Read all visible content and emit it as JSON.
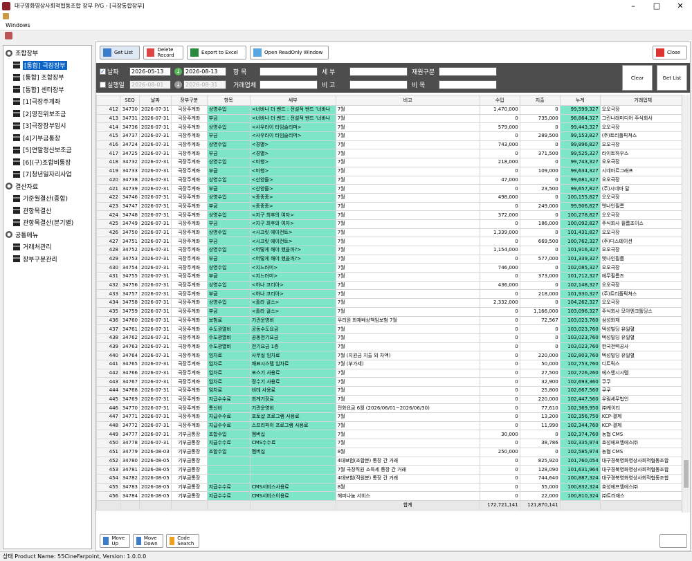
{
  "window": {
    "title": "대구영화영상사회적협동조합 장부 P/G - [극장통합장부]",
    "menu": "Windows"
  },
  "tree": [
    {
      "label": "조합장부",
      "type": "root"
    },
    {
      "label": "[통합] 극장장부",
      "type": "child",
      "selected": true
    },
    {
      "label": "[통합] 조합장부",
      "type": "child"
    },
    {
      "label": "[통합] 센터장부",
      "type": "child"
    },
    {
      "label": "[1]극장주계좌",
      "type": "child"
    },
    {
      "label": "[2]영진위보조금",
      "type": "child"
    },
    {
      "label": "[3]극장장부임시",
      "type": "child"
    },
    {
      "label": "[4]기부금통장",
      "type": "child"
    },
    {
      "label": "[5]연말정산보조금",
      "type": "child"
    },
    {
      "label": "[6](구)조합비통장",
      "type": "child"
    },
    {
      "label": "[7]청년일자리사업",
      "type": "child"
    },
    {
      "label": "결산자료",
      "type": "root"
    },
    {
      "label": "기준월결산(종합)",
      "type": "child"
    },
    {
      "label": "관항목결산",
      "type": "child"
    },
    {
      "label": "관항목결산(분기별)",
      "type": "child"
    },
    {
      "label": "공통메뉴",
      "type": "root"
    },
    {
      "label": "거래처관리",
      "type": "child"
    },
    {
      "label": "장부구분관리",
      "type": "child"
    }
  ],
  "toolbar": {
    "get_list": "Get List",
    "delete_record": "Delete Record",
    "export_excel": "Export to Excel",
    "readonly_window": "Open ReadOnly Window",
    "close": "Close"
  },
  "filter": {
    "date_label": "날짜",
    "exec_label": "실행일",
    "date_from": "2026-05-13",
    "date_to": "2026-08-13",
    "exec_from": "2026-08-01",
    "exec_to": "2026-08-31",
    "hangmok_label": "항 목",
    "semu_label": "세 부",
    "jaewon_label": "재원구분",
    "georae_label": "거래업체",
    "bigo_label": "비 고",
    "bimok_label": "비 목",
    "clear": "Clear",
    "get_list": "Get List"
  },
  "columns": [
    "SEQ",
    "날짜",
    "장부구분",
    "항목",
    "세부",
    "비고",
    "수입",
    "지출",
    "누계",
    "거래업체"
  ],
  "rows": [
    [
      "412",
      "34730",
      "2026-07-31",
      "극장주계좌",
      "상영수입",
      "<너바나 더 밴드 : 전설적 밴드 '너바나",
      "7월",
      "1,470,000",
      "0",
      "99,599,327",
      "오오극장"
    ],
    [
      "413",
      "34731",
      "2026-07-31",
      "극장주계좌",
      "부금",
      "<너바나 더 밴드 : 전설적 밴드 '너바나",
      "7월",
      "0",
      "735,000",
      "98,864,327",
      "그린나래미디어 주식회사"
    ],
    [
      "414",
      "34736",
      "2026-07-31",
      "극장주계좌",
      "상영수입",
      "<사우라이 타임슬리퍼>",
      "7월",
      "579,000",
      "0",
      "99,443,327",
      "오오극장"
    ],
    [
      "415",
      "34737",
      "2026-07-31",
      "극장주계좌",
      "부금",
      "<사우라이 타임슬리퍼>",
      "7월",
      "0",
      "289,500",
      "99,153,827",
      "(주)트리플픽쳐스"
    ],
    [
      "416",
      "34724",
      "2026-07-31",
      "극장주계좌",
      "상영수입",
      "<경멸>",
      "7월",
      "743,000",
      "0",
      "99,896,827",
      "오오극장"
    ],
    [
      "417",
      "34725",
      "2026-07-31",
      "극장주계좌",
      "부금",
      "<경멸>",
      "7월",
      "0",
      "371,500",
      "99,525,327",
      "라이트하우스"
    ],
    [
      "418",
      "34732",
      "2026-07-31",
      "극장주계좌",
      "상영수입",
      "<미행>",
      "7월",
      "218,000",
      "0",
      "99,743,327",
      "오오극장"
    ],
    [
      "419",
      "34733",
      "2026-07-31",
      "극장주계좌",
      "부금",
      "<미행>",
      "7월",
      "0",
      "109,000",
      "99,634,327",
      "시네마르그래프"
    ],
    [
      "420",
      "34738",
      "2026-07-31",
      "극장주계좌",
      "상영수입",
      "<산양들>",
      "7월",
      "47,000",
      "0",
      "99,681,327",
      "오오극장"
    ],
    [
      "421",
      "34739",
      "2026-07-31",
      "극장주계좌",
      "부금",
      "<산양들>",
      "7월",
      "0",
      "23,500",
      "99,657,827",
      "(주)시네마 달"
    ],
    [
      "422",
      "34746",
      "2026-07-31",
      "극장주계좌",
      "상영수입",
      "<종종종>",
      "7월",
      "498,000",
      "0",
      "100,155,827",
      "오오극장"
    ],
    [
      "423",
      "34747",
      "2026-07-31",
      "극장주계좌",
      "부금",
      "<종종종>",
      "7월",
      "0",
      "249,000",
      "99,906,827",
      "엣나인필름"
    ],
    [
      "424",
      "34748",
      "2026-07-31",
      "극장주계좌",
      "상영수입",
      "<지구 최후의 여자>",
      "7월",
      "372,000",
      "0",
      "100,278,827",
      "오오극장"
    ],
    [
      "425",
      "34749",
      "2026-07-31",
      "극장주계좌",
      "부금",
      "<지구 최후의 여자>",
      "7월",
      "0",
      "186,000",
      "100,092,827",
      "주식회사 필름조이스"
    ],
    [
      "426",
      "34750",
      "2026-07-31",
      "극장주계좌",
      "상영수입",
      "<시크릿 에이전트>",
      "7월",
      "1,339,000",
      "0",
      "101,431,827",
      "오오극장"
    ],
    [
      "427",
      "34751",
      "2026-07-31",
      "극장주계좌",
      "부금",
      "<시크릿 에이전트>",
      "7월",
      "0",
      "669,500",
      "100,762,327",
      "(주)디스테이션"
    ],
    [
      "428",
      "34752",
      "2026-07-31",
      "극장주계좌",
      "상영수입",
      "<어떻게 해야 했을까?>",
      "7월",
      "1,154,000",
      "0",
      "101,916,327",
      "오오극장"
    ],
    [
      "429",
      "34753",
      "2026-07-31",
      "극장주계좌",
      "부금",
      "<어떻게 해야 했을까?>",
      "7월",
      "0",
      "577,000",
      "101,339,327",
      "엣나인필름"
    ],
    [
      "430",
      "34754",
      "2026-07-31",
      "극장주계좌",
      "상영수입",
      "<지느러미>",
      "7월",
      "746,000",
      "0",
      "102,085,327",
      "오오극장"
    ],
    [
      "431",
      "34755",
      "2026-07-31",
      "극장주계좌",
      "부금",
      "<지느러미>",
      "7월",
      "0",
      "373,000",
      "101,712,327",
      "에무필름즈"
    ],
    [
      "432",
      "34756",
      "2026-07-31",
      "극장주계좌",
      "상영수입",
      "<하나 코리아>",
      "7월",
      "436,000",
      "0",
      "102,148,327",
      "오오극장"
    ],
    [
      "433",
      "34757",
      "2026-07-31",
      "극장주계좌",
      "부금",
      "<하나 코리아>",
      "7월",
      "0",
      "218,000",
      "101,930,327",
      "(주)트리플픽쳐스"
    ],
    [
      "434",
      "34758",
      "2026-07-31",
      "극장주계좌",
      "상영수입",
      "<홀라 걸스>",
      "7월",
      "2,332,000",
      "0",
      "104,262,327",
      "오오극장"
    ],
    [
      "435",
      "34759",
      "2026-07-31",
      "극장주계좌",
      "부금",
      "<홀라 걸스>",
      "7월",
      "0",
      "1,166,000",
      "103,096,327",
      "주식회사 모아엔크톨딩스"
    ],
    [
      "436",
      "34760",
      "2026-07-31",
      "극장주계좌",
      "보험료",
      "기관운영비",
      "우리원 화재배상책임보험 7월",
      "0",
      "72,567",
      "103,023,760",
      "삼성화재"
    ],
    [
      "437",
      "34761",
      "2026-07-31",
      "극장주계좌",
      "수도광열비",
      "공동수도요금",
      "7월",
      "0",
      "0",
      "103,023,760",
      "텍성빌딩 유일혈"
    ],
    [
      "438",
      "34762",
      "2026-07-31",
      "극장주계좌",
      "수도광열비",
      "공동전기요금",
      "7월",
      "0",
      "0",
      "103,023,760",
      "텍성빌딩 유일혈"
    ],
    [
      "439",
      "34763",
      "2026-07-31",
      "극장주계좌",
      "수도광열비",
      "전기요금 1층",
      "7월",
      "0",
      "0",
      "103,023,760",
      "한국전력공사"
    ],
    [
      "440",
      "34764",
      "2026-07-31",
      "극장주계좌",
      "임차료",
      "사무실 임차료",
      "7월 (지원금 지출 외 차액)",
      "0",
      "220,000",
      "102,803,760",
      "텍성빌딩 유일혈"
    ],
    [
      "441",
      "34765",
      "2026-07-31",
      "극장주계좌",
      "임차료",
      "매표시스템 임차료",
      "7월 (부가세)",
      "0",
      "50,000",
      "102,753,760",
      "디트릭스"
    ],
    [
      "442",
      "34766",
      "2026-07-31",
      "극장주계좌",
      "임차료",
      "포스기 사용료",
      "7월",
      "0",
      "27,500",
      "102,726,260",
      "에스앤시시템"
    ],
    [
      "443",
      "34767",
      "2026-07-31",
      "극장주계좌",
      "임차료",
      "정수기 사용료",
      "7월",
      "0",
      "32,900",
      "102,693,360",
      "쿠쿠"
    ],
    [
      "444",
      "34768",
      "2026-07-31",
      "극장주계좌",
      "임차료",
      "비데 사용료",
      "7월",
      "0",
      "25,800",
      "102,667,560",
      "쿠쿠"
    ],
    [
      "445",
      "34769",
      "2026-07-31",
      "극장주계좌",
      "지급수수료",
      "회계기장료",
      "7월",
      "0",
      "220,000",
      "102,447,560",
      "우림세무법인"
    ],
    [
      "446",
      "34770",
      "2026-07-31",
      "극장주계좌",
      "통신비",
      "기관운영비",
      "전화요금 6월 (2026/06/01~2026/06/30)",
      "0",
      "77,610",
      "102,369,950",
      "㈜케이티"
    ],
    [
      "447",
      "34771",
      "2026-07-31",
      "극장주계좌",
      "지급수수료",
      "포토샵 프로그램 사용료",
      "7월",
      "0",
      "13,200",
      "102,356,750",
      "KCP-결제"
    ],
    [
      "448",
      "34772",
      "2026-07-31",
      "극장주계좌",
      "지급수수료",
      "스프리파이 프로그램 사용료",
      "7월",
      "0",
      "11,990",
      "102,344,760",
      "KCP-결제"
    ],
    [
      "449",
      "34777",
      "2026-07-31",
      "기부금통장",
      "조합수입",
      "멤버십",
      "7월",
      "30,000",
      "0",
      "102,374,760",
      "농협 CMS"
    ],
    [
      "450",
      "34778",
      "2026-07-31",
      "기부금통장",
      "지급수수료",
      "CMS수수료",
      "7월",
      "0",
      "38,786",
      "102,335,974",
      "효성에프엠에스㈜"
    ],
    [
      "451",
      "34779",
      "2026-08-03",
      "기부금통장",
      "조합수입",
      "멤버십",
      "8월",
      "250,000",
      "0",
      "102,585,974",
      "농협 CMS"
    ],
    [
      "452",
      "34780",
      "2026-08-05",
      "기부금통장",
      "",
      "",
      "4대보험(조합분) 통장 간 거래",
      "0",
      "825,920",
      "101,760,054",
      "대구경북영화영상사회적협동조합"
    ],
    [
      "453",
      "34781",
      "2026-08-05",
      "기부금통장",
      "",
      "",
      "7월 극장직원 소득세 통장 간 거래",
      "0",
      "128,090",
      "101,631,964",
      "대구경북영화영상사회적협동조합"
    ],
    [
      "454",
      "34782",
      "2026-08-05",
      "기부금통장",
      "",
      "",
      "4대보험(직원분) 통장 간 거래",
      "0",
      "744,640",
      "100,887,324",
      "대구경북영화영상사회적협동조합"
    ],
    [
      "455",
      "34783",
      "2026-08-05",
      "기부금통장",
      "지급수수료",
      "CMS서비스사용료",
      "8월",
      "0",
      "55,000",
      "100,832,324",
      "효성에프엠에스㈜"
    ],
    [
      "456",
      "34784",
      "2026-08-05",
      "기부금통장",
      "지급수수료",
      "CMS서비스이용료",
      "해피나눔 서비스",
      "0",
      "22,000",
      "100,810,324",
      "㈜트라재스"
    ]
  ],
  "summary": {
    "label": "합계",
    "income": "172,721,141",
    "expense": "121,870,141"
  },
  "bottom": {
    "move_up": "Move Up",
    "move_down": "Move Down",
    "code_search": "Code Search"
  },
  "status": "상태  Product Name: 55CineFarpoint, Version: 1.0.0.0"
}
